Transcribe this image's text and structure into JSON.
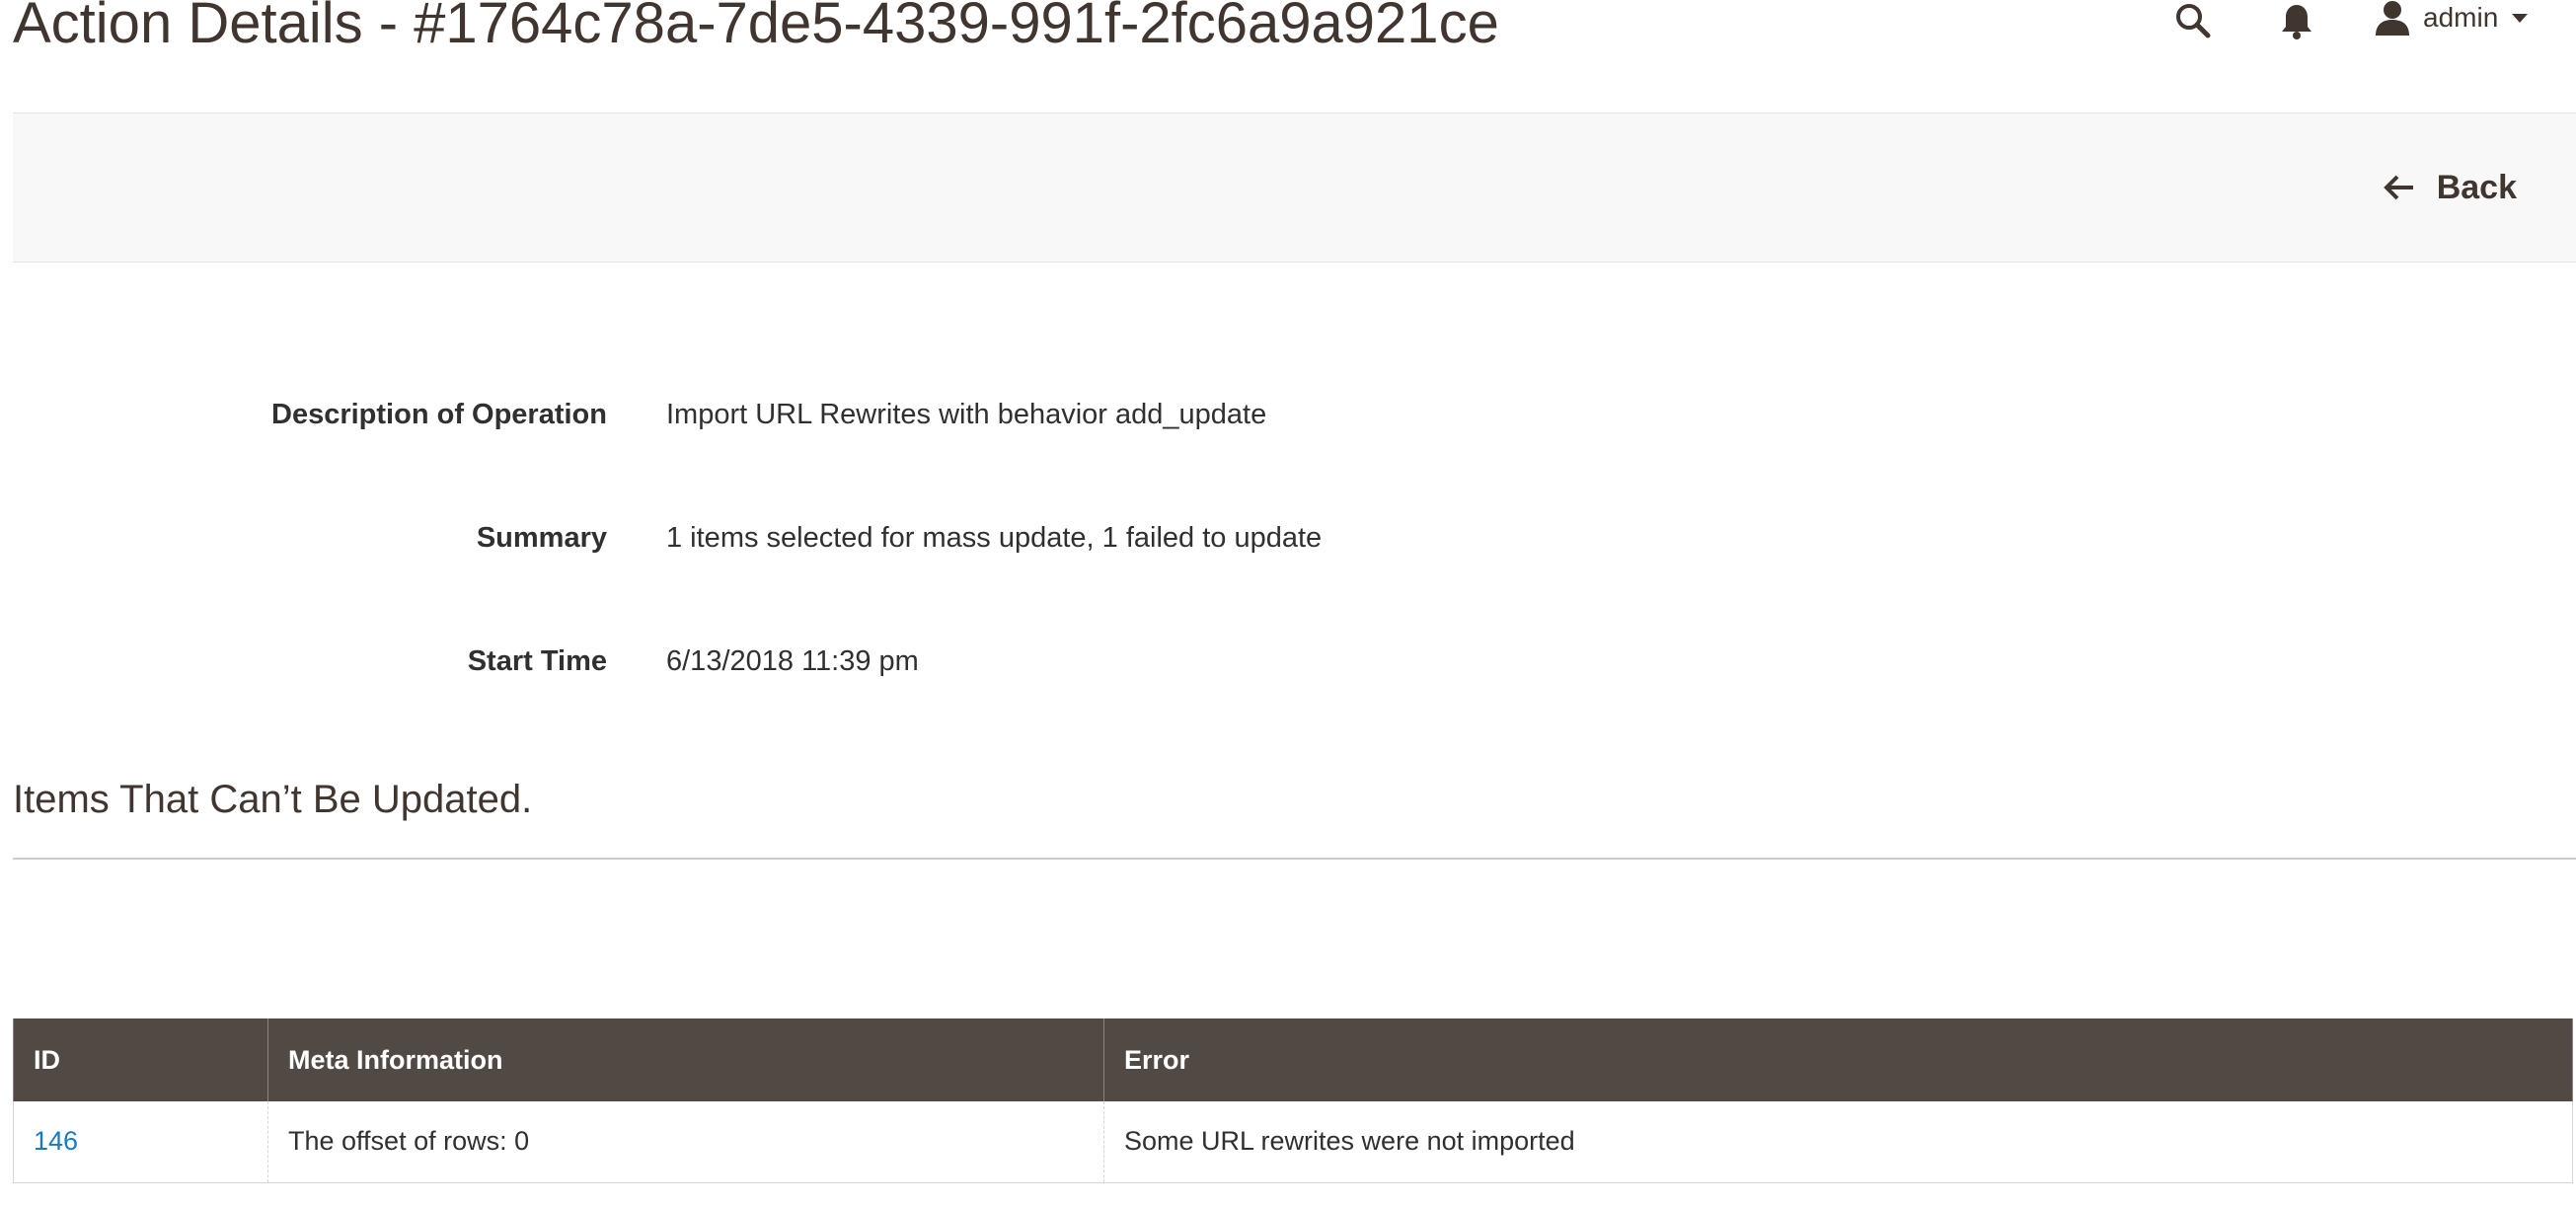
{
  "header": {
    "title": "Action Details - #1764c78a-7de5-4339-991f-2fc6a9a921ce",
    "user_name": "admin",
    "icons": {
      "search": "search-icon",
      "notifications": "bell-icon",
      "user": "user-icon",
      "dropdown": "caret-down-icon"
    }
  },
  "actions": {
    "back_label": "Back",
    "back_icon": "arrow-left-icon"
  },
  "info": {
    "description": {
      "label": "Description of Operation",
      "value": "Import URL Rewrites with behavior add_update"
    },
    "summary": {
      "label": "Summary",
      "value": "1 items selected for mass update, 1 failed to update"
    },
    "start_time": {
      "label": "Start Time",
      "value": "6/13/2018 11:39 pm"
    }
  },
  "failed_items": {
    "title": "Items That Can’t Be Updated.",
    "columns": [
      "ID",
      "Meta Information",
      "Error"
    ],
    "rows": [
      {
        "id": "146",
        "meta": "The offset of rows: 0",
        "error": "Some URL rewrites were not imported"
      }
    ]
  },
  "colors": {
    "header_text": "#41362f",
    "table_header_bg": "#514943",
    "link": "#1979c3",
    "actions_bar_bg": "#f8f8f8"
  }
}
